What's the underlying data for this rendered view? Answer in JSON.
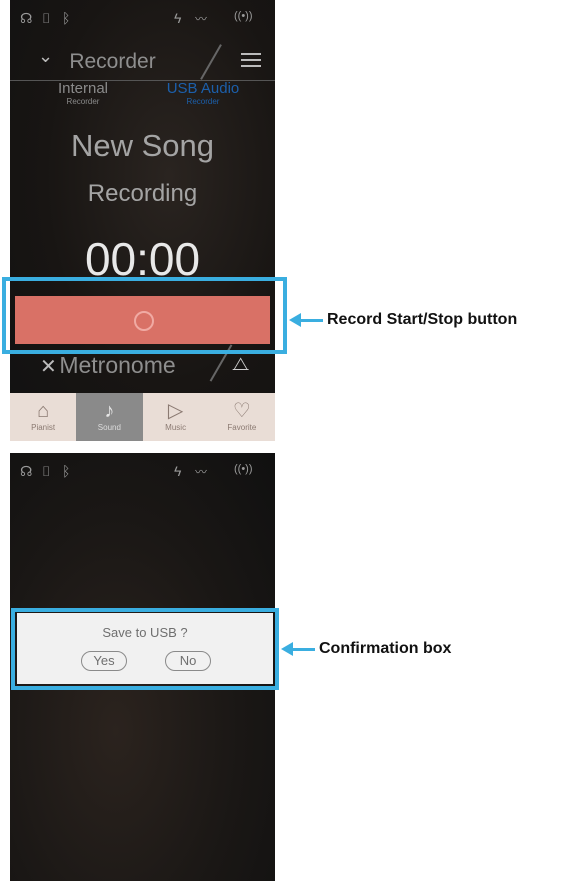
{
  "screen1": {
    "status_icons": [
      "headphones-icon",
      "usb-icon",
      "bluetooth-icon",
      "power-icon",
      "audio-wave-icon",
      "wireless-icon"
    ],
    "header_title": "Recorder",
    "tabs": [
      {
        "main": "Internal",
        "sub": "Recorder"
      },
      {
        "main": "USB Audio",
        "sub": "Recorder"
      }
    ],
    "song_name": "New Song",
    "status_text": "Recording",
    "time": "00:00",
    "metronome_label": "Metronome",
    "nav": [
      "Pianist",
      "Sound",
      "Music",
      "Favorite"
    ]
  },
  "screen2": {
    "dialog_message": "Save to USB ?",
    "yes_label": "Yes",
    "no_label": "No"
  },
  "callouts": {
    "record": "Record Start/Stop button",
    "confirm": "Confirmation box"
  },
  "colors": {
    "highlight": "#3aaee0",
    "record_button": "#d97166",
    "active_tab": "#1c5faa"
  }
}
